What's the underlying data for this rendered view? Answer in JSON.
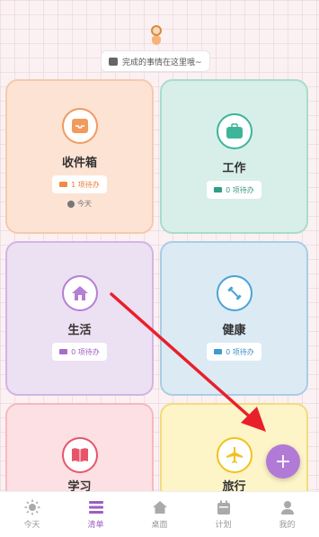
{
  "hint": {
    "text": "完成的事情在这里哦~"
  },
  "cards": {
    "inbox": {
      "title": "收件箱",
      "badge": "1 项待办",
      "today": "今天",
      "icon": "inbox-icon",
      "color": "#f29a5e"
    },
    "work": {
      "title": "工作",
      "badge": "0 项待办",
      "icon": "briefcase-icon",
      "color": "#3db59a"
    },
    "life": {
      "title": "生活",
      "badge": "0 项待办",
      "icon": "home-icon",
      "color": "#b57fd4"
    },
    "health": {
      "title": "健康",
      "badge": "0 项待办",
      "icon": "dumbbell-icon",
      "color": "#4aa3d8"
    },
    "study": {
      "title": "学习",
      "icon": "book-icon",
      "color": "#e8556a"
    },
    "travel": {
      "title": "旅行",
      "icon": "airplane-icon",
      "color": "#f2c21a"
    }
  },
  "fab": {
    "label": "+"
  },
  "tabs": [
    {
      "label": "今天",
      "icon": "sun-icon"
    },
    {
      "label": "清单",
      "icon": "list-icon",
      "active": true
    },
    {
      "label": "桌面",
      "icon": "home-icon"
    },
    {
      "label": "计划",
      "icon": "calendar-icon"
    },
    {
      "label": "我的",
      "icon": "person-icon"
    }
  ],
  "annotation_color": "#e8202a"
}
